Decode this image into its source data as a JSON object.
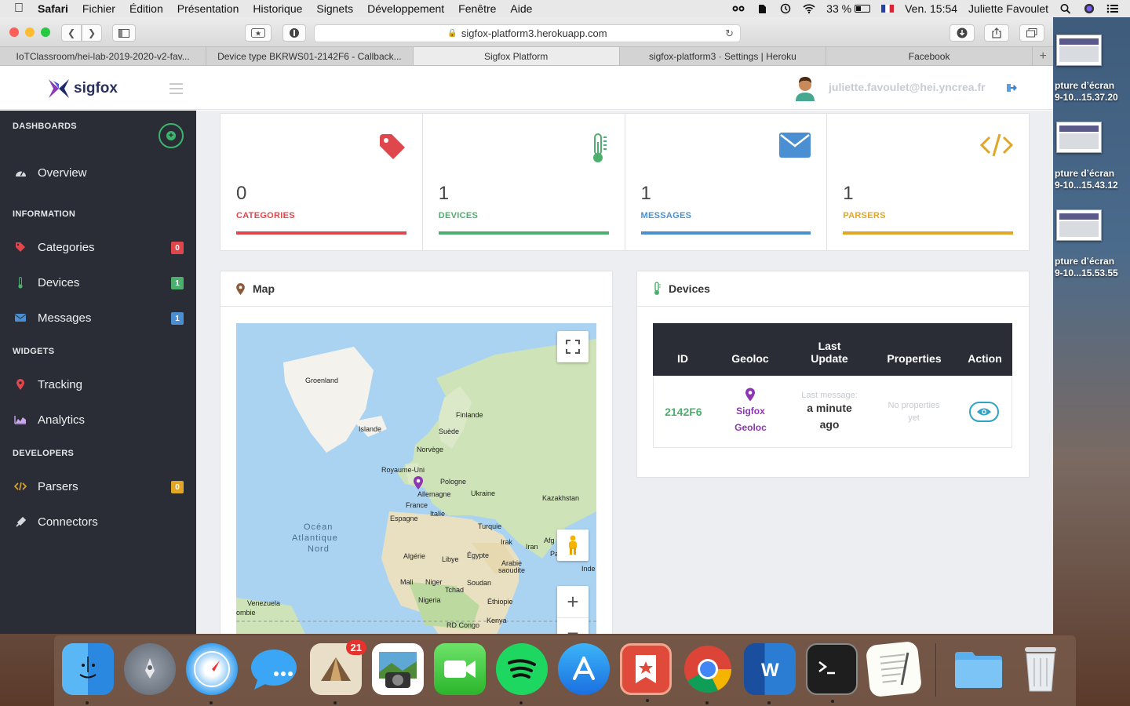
{
  "menubar": {
    "app": "Safari",
    "items": [
      "Fichier",
      "Édition",
      "Présentation",
      "Historique",
      "Signets",
      "Développement",
      "Fenêtre",
      "Aide"
    ],
    "battery": "33 %",
    "clock": "Ven. 15:54",
    "user": "Juliette Favoulet"
  },
  "browser": {
    "url": "sigfox-platform3.herokuapp.com",
    "tabs": [
      {
        "label": "IoTClassroom/hei-lab-2019-2020-v2-fav...",
        "active": false
      },
      {
        "label": "Device type BKRWS01-2142F6 - Callback...",
        "active": false
      },
      {
        "label": "Sigfox Platform",
        "active": true
      },
      {
        "label": "sigfox-platform3 · Settings | Heroku",
        "active": false
      },
      {
        "label": "Facebook",
        "active": false
      }
    ]
  },
  "header": {
    "logo_text": "sigfox",
    "user_email": "juliette.favoulet@hei.yncrea.fr"
  },
  "sidebar": {
    "sections": {
      "dashboards": "DASHBOARDS",
      "information": "INFORMATION",
      "widgets": "WIDGETS",
      "developers": "DEVELOPERS"
    },
    "items": {
      "overview": "Overview",
      "categories": {
        "label": "Categories",
        "count": "0"
      },
      "devices": {
        "label": "Devices",
        "count": "1"
      },
      "messages": {
        "label": "Messages",
        "count": "1"
      },
      "tracking": "Tracking",
      "analytics": "Analytics",
      "parsers": {
        "label": "Parsers",
        "count": "0"
      },
      "connectors": "Connectors"
    }
  },
  "stats": [
    {
      "value": "0",
      "label": "CATEGORIES",
      "color": "#e0474c",
      "icon": "tag-icon"
    },
    {
      "value": "1",
      "label": "DEVICES",
      "color": "#4caf6e",
      "icon": "thermometer-icon"
    },
    {
      "value": "1",
      "label": "MESSAGES",
      "color": "#4a8fd1",
      "icon": "envelope-icon"
    },
    {
      "value": "1",
      "label": "PARSERS",
      "color": "#e0a628",
      "icon": "code-icon"
    }
  ],
  "map_panel": {
    "title": "Map",
    "labels": {
      "greenland": "Groenland",
      "iceland": "Islande",
      "finland": "Finlande",
      "sweden": "Suède",
      "norway": "Norvège",
      "uk": "Royaume-Uni",
      "poland": "Pologne",
      "germany": "Allemagne",
      "ukraine": "Ukraine",
      "kazakhstan": "Kazakhstan",
      "france": "France",
      "spain": "Espagne",
      "italy": "Italie",
      "turkey": "Turquie",
      "ocean1": "Océan",
      "ocean2": "Atlantique",
      "ocean3": "Nord",
      "iraq": "Irak",
      "iran": "Iran",
      "afg": "Afg",
      "pak": "Pa",
      "algeria": "Algérie",
      "libya": "Libye",
      "egypt": "Égypte",
      "saudi1": "Arabie",
      "saudi2": "saoudite",
      "india": "Inde",
      "mali": "Mali",
      "niger": "Niger",
      "chad": "Tchad",
      "sudan": "Soudan",
      "venezuela": "Venezuela",
      "colombia": "ombie",
      "nigeria": "Nigeria",
      "ethiopia": "Éthiopie",
      "kenya": "Kenya",
      "drc": "RD Congo"
    },
    "zoom_in": "+",
    "zoom_out": "−"
  },
  "devices_panel": {
    "title": "Devices",
    "columns": [
      "ID",
      "Geoloc",
      "Last Update",
      "Properties",
      "Action"
    ],
    "rows": [
      {
        "id": "2142F6",
        "geoloc": "Sigfox Geoloc",
        "last_message_label": "Last message:",
        "last_update": "a minute ago",
        "properties": "No properties yet"
      }
    ]
  },
  "desktop_files": [
    {
      "line1": "pture d’écran",
      "line2": "9-10...15.37.20"
    },
    {
      "line1": "pture d’écran",
      "line2": "9-10...15.43.12"
    },
    {
      "line1": "pture d’écran",
      "line2": "9-10...15.53.55"
    }
  ],
  "dock": {
    "mail_badge": "21"
  },
  "colors": {
    "sidebar_bg": "#2a2d35",
    "accent_green": "#3bb56b",
    "device_id_green": "#4caf6e",
    "geoloc_purple": "#8e35b5"
  }
}
